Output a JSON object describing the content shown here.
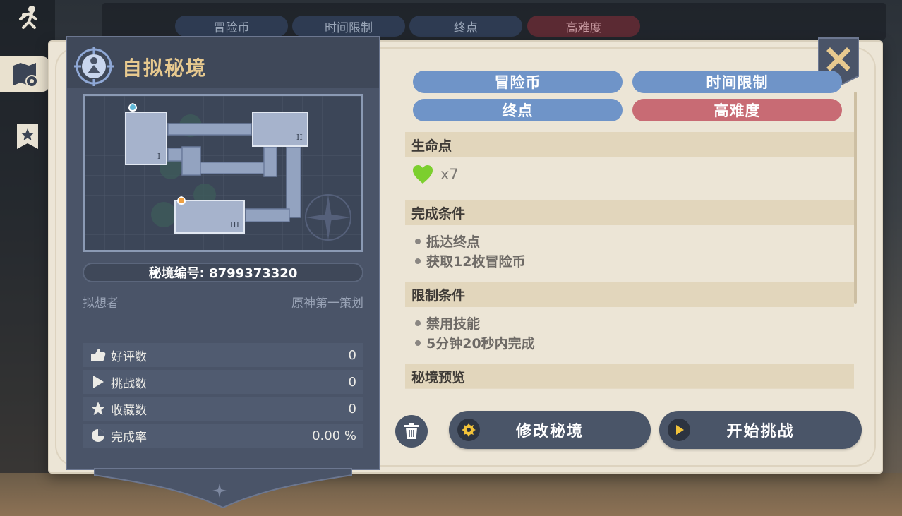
{
  "background": {
    "tags": [
      "冒险币",
      "时间限制",
      "终点",
      "高难度"
    ]
  },
  "panel": {
    "title": "自拟秘境",
    "domain_id_label": "秘境编号: 8799373320",
    "creator_label": "拟想者",
    "creator_name": "原神第一策划",
    "stats": [
      {
        "icon": "thumbs-up-icon",
        "label": "好评数",
        "value": "0"
      },
      {
        "icon": "play-icon",
        "label": "挑战数",
        "value": "0"
      },
      {
        "icon": "star-icon",
        "label": "收藏数",
        "value": "0"
      },
      {
        "icon": "pie-chart-icon",
        "label": "完成率",
        "value": "0.00 %"
      }
    ],
    "map_room_labels": [
      "I",
      "II",
      "III"
    ]
  },
  "tags": [
    {
      "label": "冒险币",
      "color": "#6f94c8"
    },
    {
      "label": "时间限制",
      "color": "#6f94c8"
    },
    {
      "label": "终点",
      "color": "#6f94c8"
    },
    {
      "label": "高难度",
      "color": "#c86b74"
    }
  ],
  "sections": {
    "hp": {
      "title": "生命点",
      "count": "x7"
    },
    "complete": {
      "title": "完成条件",
      "items": [
        "抵达终点",
        "获取12枚冒险币"
      ]
    },
    "limit": {
      "title": "限制条件",
      "items": [
        "禁用技能",
        "5分钟20秒内完成"
      ]
    },
    "preview": {
      "title": "秘境预览"
    }
  },
  "buttons": {
    "edit": "修改秘境",
    "start": "开始挑战"
  },
  "colors": {
    "panel_dark": "#4a5468",
    "cream": "#ece5d6",
    "title_gold": "#e7c98f",
    "heart_green": "#7ccf2e",
    "tag_blue": "#6f94c8",
    "tag_red": "#c86b74"
  }
}
